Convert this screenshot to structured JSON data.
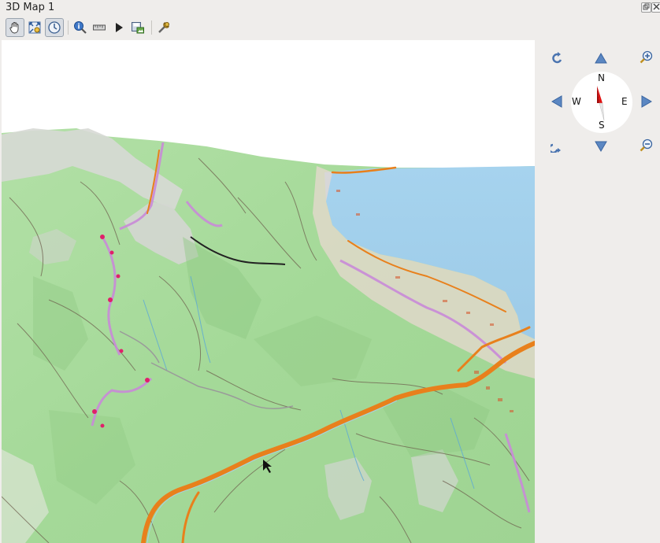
{
  "window": {
    "title": "3D Map 1"
  },
  "toolbar": {
    "tools": [
      {
        "name": "camera-control-icon",
        "active": true
      },
      {
        "name": "zoom-full-icon",
        "active": false
      },
      {
        "name": "sync-icon",
        "active": true
      },
      {
        "name": "identify-icon",
        "active": false
      },
      {
        "name": "measure-line-icon",
        "active": false
      },
      {
        "name": "animation-play-icon",
        "active": false
      },
      {
        "name": "save-image-icon",
        "active": false
      },
      {
        "name": "configure-icon",
        "active": false
      }
    ]
  },
  "compass": {
    "north": "N",
    "south": "S",
    "east": "E",
    "west": "W"
  },
  "colors": {
    "water": "#a8d4ee",
    "terrain": "#a9dd9c",
    "road": "#e8801c",
    "trail": "#c78ad8",
    "nav_arrow": "#5b87c2",
    "compass_red": "#e01010"
  }
}
